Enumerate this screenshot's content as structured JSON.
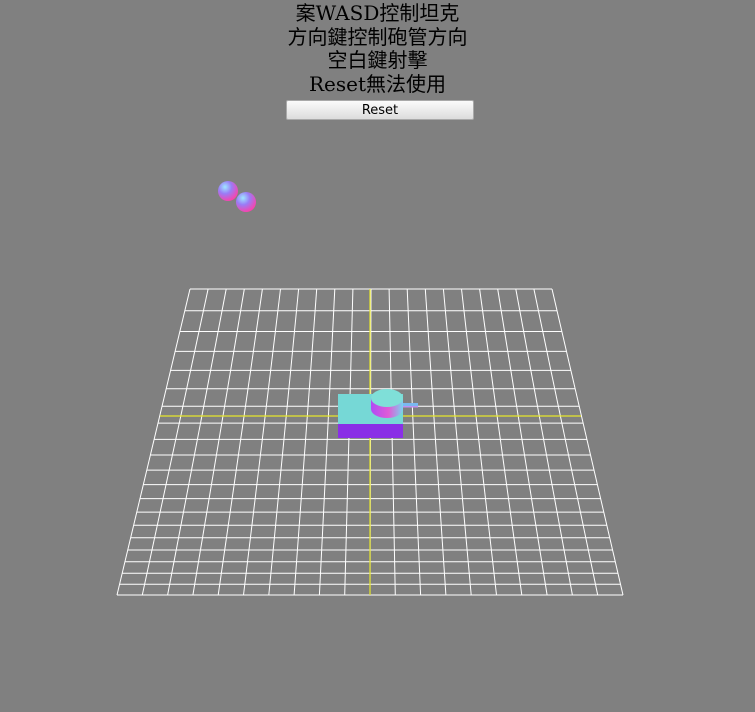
{
  "instructions": {
    "line1": "案WASD控制坦克",
    "line2": "方向鍵控制砲管方向",
    "line3": "空白鍵射擊",
    "line4": "Reset無法使用"
  },
  "reset_button": {
    "label": "Reset"
  },
  "colors": {
    "background": "#808080",
    "grid": "#ffffff",
    "axis": "#e6e62a",
    "tank_top": "#76d8d6",
    "tank_bottom": "#8a2fe6"
  }
}
